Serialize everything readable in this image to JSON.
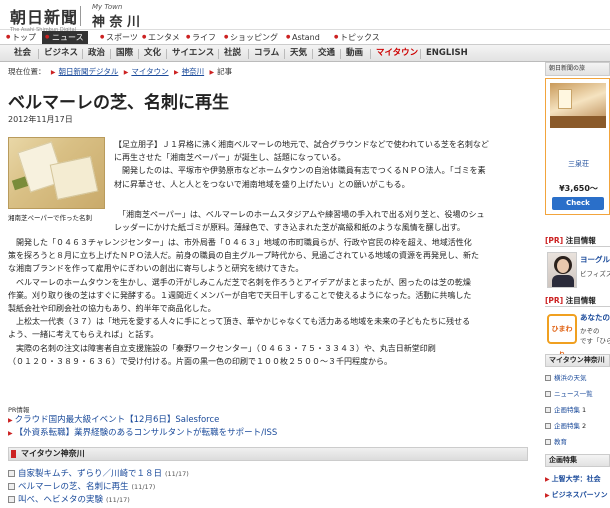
{
  "header": {
    "logo_text": "朝日新聞",
    "logo_sub": "The Asahi Shimbun Digital",
    "mytown_small": "My Town",
    "mytown_big": "神 奈 川"
  },
  "primary_nav": [
    "トップ",
    "ニュース",
    "スポーツ",
    "エンタメ",
    "ライフ",
    "ショッピング",
    "Astand",
    "トピックス"
  ],
  "secondary_nav": [
    "社会",
    "ビジネス",
    "政治",
    "国際",
    "文化",
    "サイエンス",
    "社説",
    "コラム",
    "天気",
    "交通",
    "動画",
    "マイタウン",
    "ENGLISH"
  ],
  "breadcrumb": {
    "prefix": "現在位置：",
    "items": [
      "朝日新聞デジタル",
      "マイタウン",
      "神奈川"
    ],
    "current": "記事"
  },
  "article": {
    "title": "ベルマーレの芝、名刺に再生",
    "date": "2012年11月17日",
    "photo_caption": "湘南芝ペーパーで作った名刺",
    "lead": [
      "【足立朋子】Ｊ１昇格に沸く湘南ベルマーレの地元で、試合グラウンドなどで使われている芝を名刺など",
      "に再生させた「湘南芝ペーパー」が誕生し、話題になっている。",
      "　開発したのは、平塚市や伊勢原市などホームタウンの自治体職員有志でつくるＮＰＯ法人。「ゴミを素",
      "材に昇華させ、人と人とをつないで湘南地域を盛り上げたい」との願いがこもる。"
    ],
    "body": [
      "　「湘南芝ペーパー」は、ベルマーレのホームスタジアムや練習場の手入れで出る刈り芝と、役場のシュ",
      "レッダーにかけた紙ゴミが原料。薄緑色で、すき込まれた芝が高級和紙のような風情を醸し出す。",
      "　開発した「０４６３チャレンジセンター」は、市外局番「０４６３」地域の市町職員らが、行政や官民の枠を超え、地域活性化",
      "策を探ろうと８月に立ち上げたＮＰＯ法人だ。前身の職員の自主グループ時代から、見過ごされている地域の資源を再発見し、新た",
      "な湘南ブランドを作って雇用やにぎわいの創出に寄与しようと研究を続けてきた。",
      "　ベルマーレのホームタウンを生かし、選手の汗がしみこんだ芝で名刺を作ろうとアイデアがまとまったが、困ったのは芝の乾燥",
      "作業。刈り取り後の芝はすぐに発酵する。１週間近くメンバーが自宅で天日干しすることで使えるようになった。活動に共鳴した",
      "製紙会社や印刷会社の協力もあり、約半年で商品化した。",
      "　上松太一代表（３７）は「地元を愛する人々に手にとって頂き、華やかじゃなくても活力ある地域を未来の子どもたちに残せる",
      "よう、一緒に考えてもらえれば」と話す。",
      "　実際の名刺の注文は障害者自立支援施設の「秦野ワークセンター」（０４６３・７５・３３４３）や、丸吉日新堂印刷",
      "（０１２０・３８９・６３６）で受け付ける。片面の黒一色の印刷で１００枚２５００～３千円程度から。"
    ]
  },
  "pr": {
    "label": "PR情報",
    "links": [
      "クラウド国内最大級イベント【12月6日】Salesforce",
      "【外資系転職】業界経験のあるコンサルタントが転職をサポート/ISS"
    ]
  },
  "mytown_section": {
    "title": "マイタウン神奈川",
    "items": [
      {
        "title": "自家製キムチ、ずらり／川崎で１８日",
        "date": "(11/17)"
      },
      {
        "title": "ベルマーレの芝、名刺に再生",
        "date": "(11/17)"
      },
      {
        "title": "叫べ、ヘビメタの実験",
        "date": "(11/17)"
      }
    ]
  },
  "sidebar": {
    "ad_header": "朝日新聞の旅",
    "ad_name": "三泉荘",
    "ad_price": "¥3,650～",
    "ad_check": "Check",
    "pr1_label": "[PR]",
    "pr1_title": "注目情報",
    "pr1_link": "ヨーグルト",
    "pr1_sub": "ビフィズス菌",
    "pr2_label": "[PR]",
    "pr2_title": "注目情報",
    "pr2_link": "あなたの",
    "pr2_sub1": "かぞの",
    "pr2_sub2": "です「ひらが",
    "pr2_logo": "ひまわり",
    "mytown_head": "マイタウン神奈川",
    "mytown_items": [
      {
        "label": "横浜の天気",
        "n": ""
      },
      {
        "label": "ニュース一覧",
        "n": ""
      },
      {
        "label": "企画特集",
        "n": "1"
      },
      {
        "label": "企画特集",
        "n": "2"
      },
      {
        "label": "教育",
        "n": ""
      }
    ],
    "feat_head": "企画特集",
    "feat_items": [
      "上智大学：社会",
      "ビジネスパーソン"
    ]
  }
}
